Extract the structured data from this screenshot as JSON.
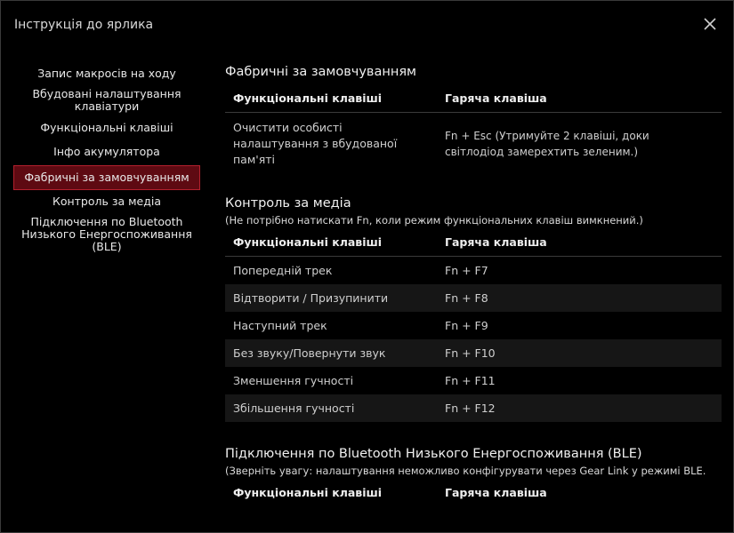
{
  "window": {
    "title": "Інструкція до ярлика"
  },
  "sidebar": {
    "items": [
      {
        "label": "Запис макросів на ходу"
      },
      {
        "label": "Вбудовані налаштування клавіатури"
      },
      {
        "label": "Функціональні клавіші"
      },
      {
        "label": "Інфо акумулятора"
      },
      {
        "label": "Фабричні за замовчуванням"
      },
      {
        "label": "Контроль за медіа"
      },
      {
        "label": "Підключення по Bluetooth Низького Енергоспоживання (BLE)"
      }
    ],
    "active_index": 4
  },
  "sections": {
    "factory": {
      "title": "Фабричні за замовчуванням",
      "col1": "Функціональні клавіші",
      "col2": "Гаряча клавіша",
      "rows": [
        {
          "func": "Очистити особисті налаштування з вбудованої пам'яті",
          "hotkey": "Fn + Esc (Утримуйте 2 клавіші, доки світлодіод замерехтить зеленим.)"
        }
      ]
    },
    "media": {
      "title": "Контроль за медіа",
      "note": "(Не потрібно натискати Fn, коли режим функціональних клавіш вимкнений.)",
      "col1": "Функціональні клавіші",
      "col2": "Гаряча клавіша",
      "rows": [
        {
          "func": "Попередній трек",
          "hotkey": "Fn + F7"
        },
        {
          "func": "Відтворити / Призупинити",
          "hotkey": "Fn + F8"
        },
        {
          "func": "Наступний трек",
          "hotkey": "Fn + F9"
        },
        {
          "func": "Без звуку/Повернути звук",
          "hotkey": "Fn + F10"
        },
        {
          "func": "Зменшення гучності",
          "hotkey": "Fn + F11"
        },
        {
          "func": "Збільшення гучності",
          "hotkey": "Fn + F12"
        }
      ]
    },
    "ble": {
      "title": "Підключення по Bluetooth Низького Енергоспоживання (BLE)",
      "note": "(Зверніть увагу: налаштування неможливо конфігурувати через Gear Link у режимі BLE.",
      "col1": "Функціональні клавіші",
      "col2": "Гаряча клавіша"
    }
  },
  "icons": {
    "close": "close-icon"
  },
  "colors": {
    "accent_bg": "#5e0a12",
    "accent_border": "#b3202d",
    "row_alt": "#161616"
  }
}
